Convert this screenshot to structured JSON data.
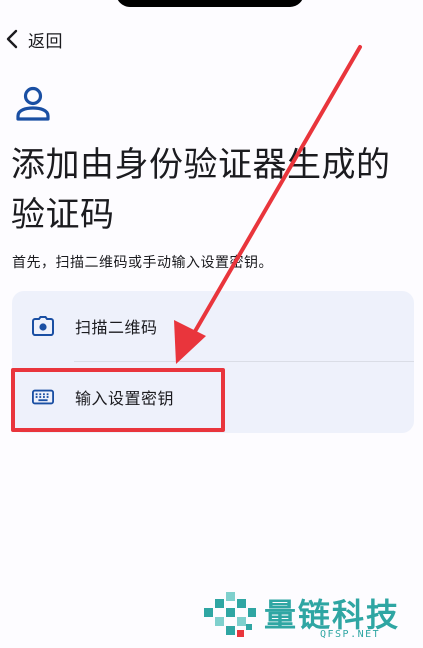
{
  "header": {
    "back_label": "返回"
  },
  "page": {
    "icon": "person-icon",
    "title": "添加由身份验证器生成的验证码",
    "subtitle": "首先，扫描二维码或手动输入设置密钥。"
  },
  "options": [
    {
      "label": "扫描二维码",
      "icon": "camera-icon"
    },
    {
      "label": "输入设置密钥",
      "icon": "keyboard-icon"
    }
  ],
  "annotation": {
    "highlight_color": "#e9353c",
    "target": "输入设置密钥"
  },
  "watermark": {
    "brand": "量链科技",
    "domain": "QFSP.NET",
    "color": "#2fa6a3"
  },
  "colors": {
    "accent": "#1a4fa3",
    "card_bg": "#eef1fb"
  }
}
